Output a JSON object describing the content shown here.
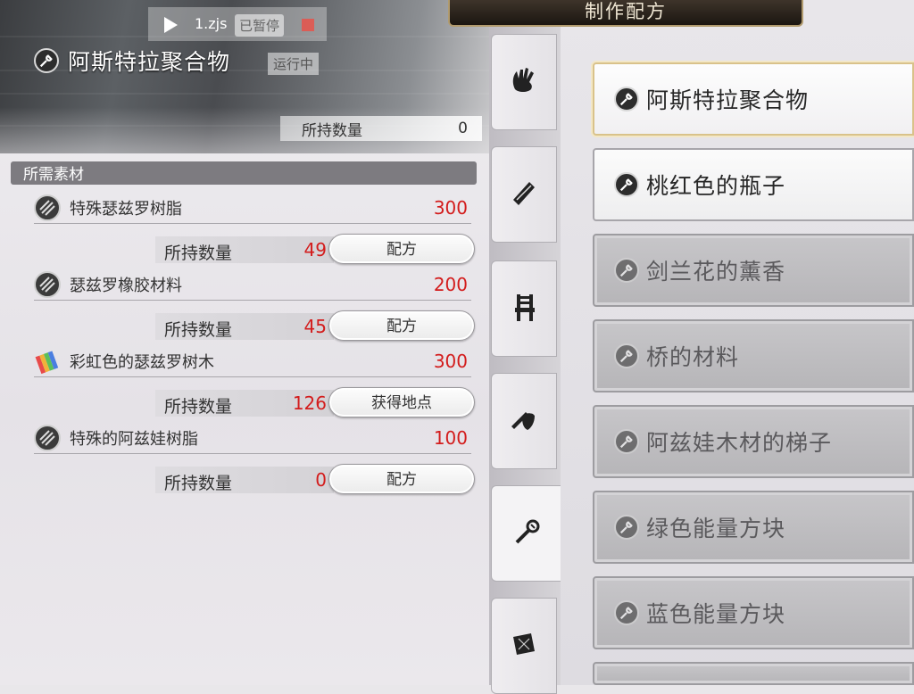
{
  "overlay": {
    "script_name": "1.zjs",
    "paused_label": "已暂停",
    "running_label": "运行中"
  },
  "panel_title": "制作配方",
  "detail": {
    "item_name": "阿斯特拉聚合物",
    "held_label": "所持数量",
    "held_value": "0",
    "section_label": "所需素材"
  },
  "materials": [
    {
      "name": "特殊瑟兹罗树脂",
      "need": "300",
      "held_label": "所持数量",
      "held": "49",
      "action": "配方",
      "icon": "resin-icon"
    },
    {
      "name": "瑟兹罗橡胶材料",
      "need": "200",
      "held_label": "所持数量",
      "held": "45",
      "action": "配方",
      "icon": "resin-icon"
    },
    {
      "name": "彩虹色的瑟兹罗树木",
      "need": "300",
      "held_label": "所持数量",
      "held": "126",
      "action": "获得地点",
      "icon": "rainbow-wood-icon"
    },
    {
      "name": "特殊的阿兹娃树脂",
      "need": "100",
      "held_label": "所持数量",
      "held": "0",
      "action": "配方",
      "icon": "resin-icon"
    }
  ],
  "tabs": [
    {
      "icon": "glove-icon"
    },
    {
      "icon": "cloth-icon"
    },
    {
      "icon": "chair-icon"
    },
    {
      "icon": "weapon-shield-icon"
    },
    {
      "icon": "tools-icon",
      "active": true
    },
    {
      "icon": "map-icon"
    }
  ],
  "recipes": [
    {
      "label": "阿斯特拉聚合物",
      "state": "selected"
    },
    {
      "label": "桃红色的瓶子",
      "state": "available"
    },
    {
      "label": "剑兰花的薰香",
      "state": "unavailable"
    },
    {
      "label": "桥的材料",
      "state": "unavailable"
    },
    {
      "label": "阿兹娃木材的梯子",
      "state": "unavailable"
    },
    {
      "label": "绿色能量方块",
      "state": "unavailable"
    },
    {
      "label": "蓝色能量方块",
      "state": "unavailable"
    }
  ],
  "colors": {
    "need_red": "#d31c1c",
    "selected_border": "#d9c28a",
    "title_bar": "#2a231c"
  }
}
